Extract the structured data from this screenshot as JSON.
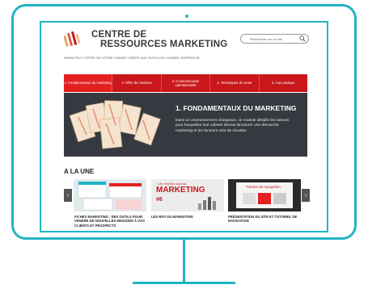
{
  "brand": {
    "line1": "CENTRE DE",
    "line2": "RESSOURCES MARKETING",
    "tagline": "MARKETEZ L'OFFRE DE VOTRE CABINET GRÂCE AUX OUTILS DU CONSEIL SUPÉRIEUR"
  },
  "search": {
    "placeholder": "Rechercher sur ce site"
  },
  "nav": {
    "items": [
      {
        "label": "1. Fondamentaux du marketing"
      },
      {
        "label": "2. Offre de missions"
      },
      {
        "label": "3. Communication opérationnelle"
      },
      {
        "label": "4. Techniques de vente"
      },
      {
        "label": "5. Cas pratique"
      }
    ]
  },
  "hero": {
    "title": "1. FONDAMENTAUX DU MARKETING",
    "text": "Dans un environnement changeant, ce module détaille les raisons pour lesquelles tout cabinet devrait structurer une démarche marketing et les facteurs-clés de réussite."
  },
  "section": {
    "title": "A LA UNE"
  },
  "carousel": {
    "items": [
      {
        "caption": "FICHES MARKETING : DES OUTILS POUR VENDRE DE NOUVELLES MISSIONS À VOS CLIENTS ET PROSPECTS"
      },
      {
        "caption": "LES RDV DU MARKETING",
        "thumb_text": "MARKETING",
        "thumb_small": "Les rendez-vous du",
        "thumb_num": "#6"
      },
      {
        "caption": "PRÉSENTATION DU SITE ET TUTORIEL DE NAVIGATION",
        "thumb_text": "Tutoriel de navigation"
      }
    ],
    "prev": "‹",
    "next": "›"
  },
  "colors": {
    "accent": "#22b4c4",
    "nav_red": "#c9171b",
    "hero_bg": "#363a40"
  }
}
